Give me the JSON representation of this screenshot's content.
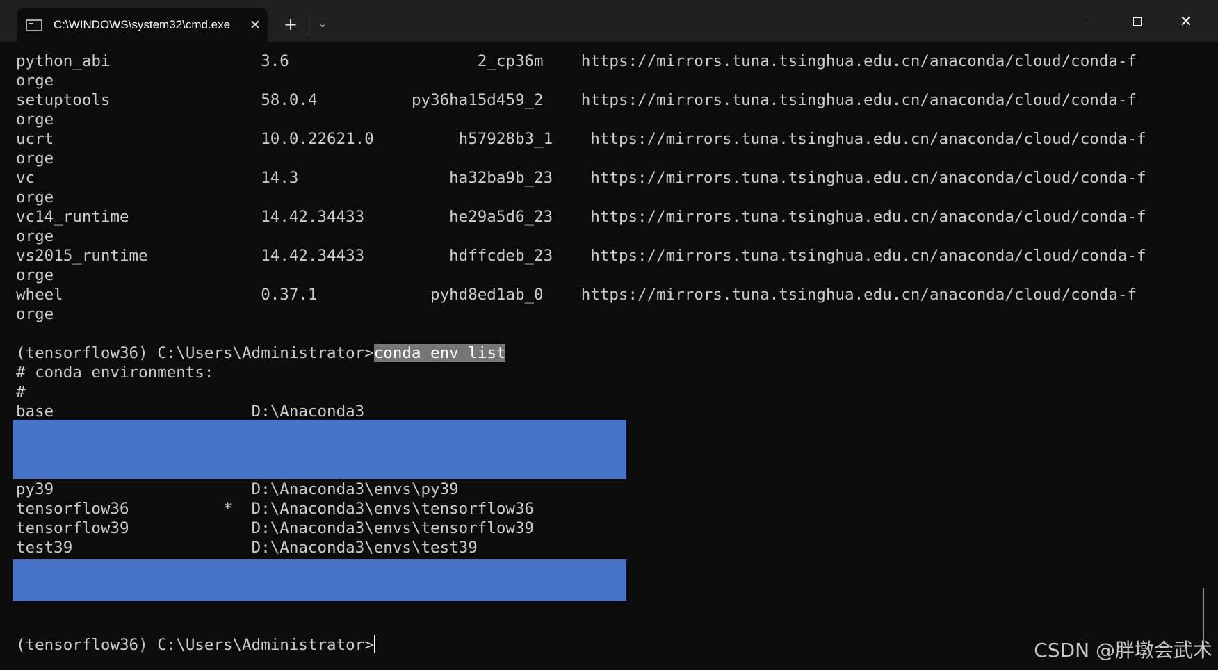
{
  "window": {
    "tab_title": "C:\\WINDOWS\\system32\\cmd.exe",
    "tab_close_glyph": "✕",
    "new_tab_glyph": "+",
    "dropdown_glyph": "⌄",
    "minimize_icon": "minimize-icon",
    "maximize_icon": "maximize-icon",
    "close_glyph": "✕"
  },
  "colors": {
    "background": "#0c0c0c",
    "text": "#cccccc",
    "selection": "#767676",
    "redaction": "#4673c8"
  },
  "terminal": {
    "lines": [
      "python_abi                3.6                    2_cp36m    https://mirrors.tuna.tsinghua.edu.cn/anaconda/cloud/conda-f",
      "orge",
      "setuptools                58.0.4          py36ha15d459_2    https://mirrors.tuna.tsinghua.edu.cn/anaconda/cloud/conda-f",
      "orge",
      "ucrt                      10.0.22621.0         h57928b3_1    https://mirrors.tuna.tsinghua.edu.cn/anaconda/cloud/conda-f",
      "orge",
      "vc                        14.3                ha32ba9b_23    https://mirrors.tuna.tsinghua.edu.cn/anaconda/cloud/conda-f",
      "orge",
      "vc14_runtime              14.42.34433         he29a5d6_23    https://mirrors.tuna.tsinghua.edu.cn/anaconda/cloud/conda-f",
      "orge",
      "vs2015_runtime            14.42.34433         hdffcdeb_23    https://mirrors.tuna.tsinghua.edu.cn/anaconda/cloud/conda-f",
      "orge",
      "wheel                     0.37.1            pyhd8ed1ab_0    https://mirrors.tuna.tsinghua.edu.cn/anaconda/cloud/conda-f",
      "orge"
    ],
    "prompt": "(tensorflow36) C:\\Users\\Administrator>",
    "command": "conda env list",
    "env_header_1": "# conda environments:",
    "env_header_2": "#",
    "env_base": "base                     D:\\Anaconda3",
    "env_lines": [
      "py39                     D:\\Anaconda3\\envs\\py39",
      "tensorflow36          *  D:\\Anaconda3\\envs\\tensorflow36",
      "tensorflow39             D:\\Anaconda3\\envs\\tensorflow39",
      "test39                   D:\\Anaconda3\\envs\\test39"
    ],
    "final_prompt": "(tensorflow36) C:\\Users\\Administrator>"
  },
  "watermark": "CSDN @胖墩会武术"
}
